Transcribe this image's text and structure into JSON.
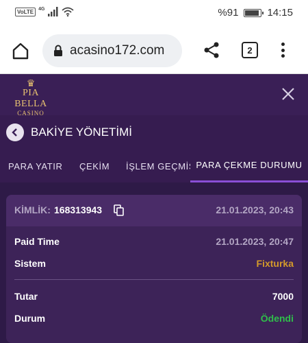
{
  "status_bar": {
    "volte": "VoLTE",
    "network": "4G",
    "battery": "%91",
    "time": "14:15",
    "battery_level": 0.91
  },
  "browser": {
    "url": "acasino172.com",
    "tab_count": "2"
  },
  "site": {
    "logo_name": "PIA BELLA",
    "logo_sub": "CASINO"
  },
  "page": {
    "title": "BAKİYE YÖNETİMİ"
  },
  "tabs": [
    {
      "label": "PARA YATIR",
      "active": false
    },
    {
      "label": "ÇEKİM",
      "active": false
    },
    {
      "label": "İŞLEM GEÇMİŞİ",
      "active": false
    },
    {
      "label": "PARA ÇEKME DURUMU",
      "active": true
    }
  ],
  "withdrawal": {
    "id_label": "KİMLİK:",
    "id_value": "168313943",
    "date": "21.01.2023, 20:43",
    "rows": [
      {
        "label": "Paid Time",
        "value": "21.01.2023, 20:47",
        "color": "#b3a6c4"
      },
      {
        "label": "Sistem",
        "value": "Fixturka",
        "color": "#d49a2a"
      },
      {
        "label": "Tutar",
        "value": "7000",
        "color": "#ffffff"
      },
      {
        "label": "Durum",
        "value": "Ödendi",
        "color": "#2fbf4a"
      }
    ]
  },
  "colors": {
    "background": "#2e1a47",
    "accent": "#8a4fd6",
    "gold": "#e7c170"
  }
}
